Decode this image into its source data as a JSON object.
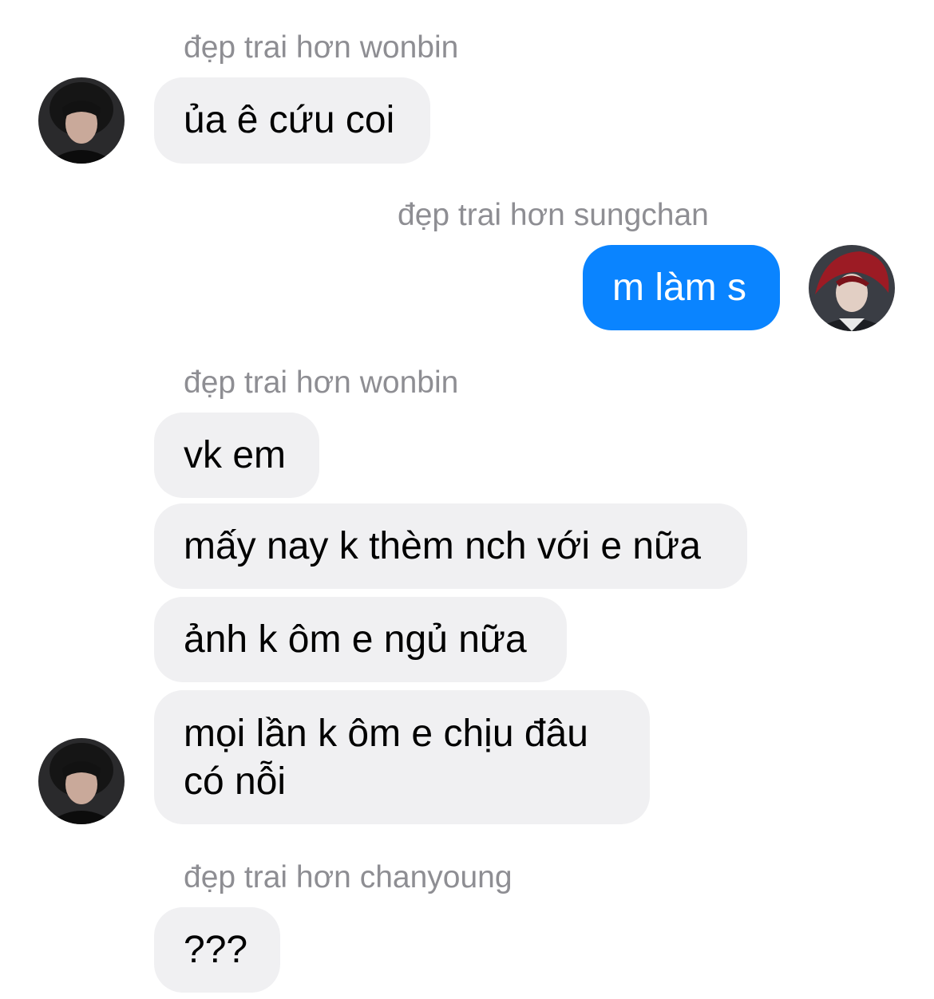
{
  "messages": [
    {
      "sender": "đẹp trai hơn wonbin",
      "text": "ủa ê cứu coi",
      "direction": "incoming"
    },
    {
      "sender": "đẹp trai hơn sungchan",
      "text": "m làm s",
      "direction": "outgoing"
    },
    {
      "sender": "đẹp trai hơn wonbin",
      "texts": [
        "vk em",
        "mấy nay k thèm nch với e nữa",
        "ảnh k ôm e ngủ nữa"
      ],
      "direction": "incoming"
    },
    {
      "line1": "mọi lần k ôm e chịu đâu",
      "line2": "có nỗi"
    },
    {
      "sender": "đẹp trai hơn chanyoung",
      "text": "???",
      "direction": "incoming"
    }
  ],
  "colors": {
    "incoming_bubble": "#f0f0f2",
    "outgoing_bubble": "#0a84ff",
    "sender_text": "#8e8e93"
  }
}
